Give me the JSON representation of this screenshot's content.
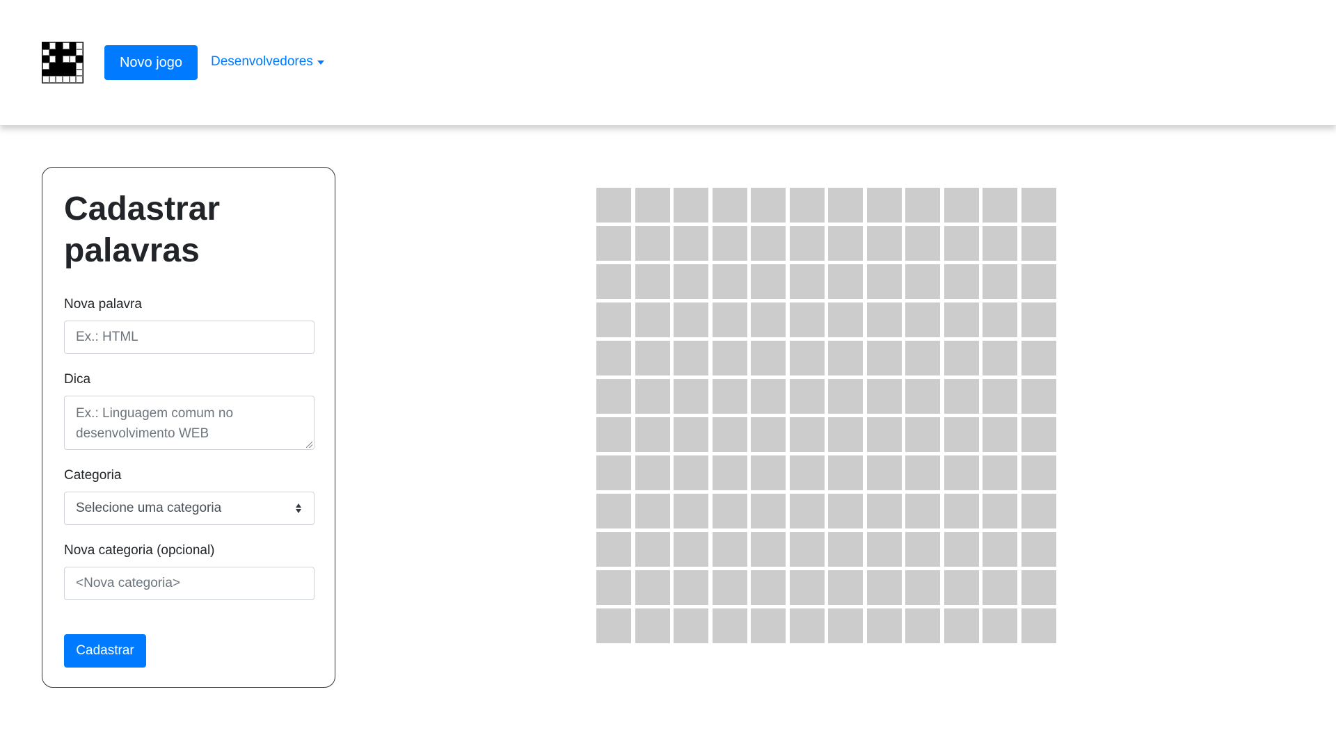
{
  "navbar": {
    "new_game_label": "Novo jogo",
    "developers_label": "Desenvolvedores",
    "accent_color": "#007bff",
    "logo_icon": "crossword-logo-icon"
  },
  "form": {
    "title": "Cadastrar palavras",
    "new_word_label": "Nova palavra",
    "new_word_placeholder": "Ex.: HTML",
    "hint_label": "Dica",
    "hint_placeholder": "Ex.: Linguagem comum no desenvolvimento WEB",
    "category_label": "Categoria",
    "category_selected": "Selecione uma categoria",
    "new_category_label": "Nova categoria (opcional)",
    "new_category_placeholder": "<Nova categoria>",
    "submit_label": "Cadastrar"
  },
  "board": {
    "rows": 12,
    "columns": 12,
    "cell_color": "#cccccc"
  }
}
